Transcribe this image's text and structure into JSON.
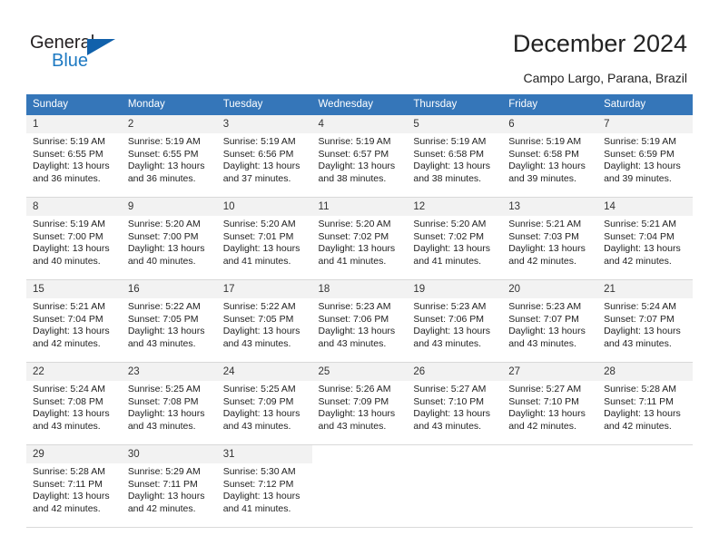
{
  "brand": {
    "name_part1": "General",
    "name_part2": "Blue",
    "triangle_icon": "triangle-icon",
    "color_dark": "#231f20",
    "color_blue": "#1d79c2"
  },
  "header": {
    "title": "December 2024",
    "subtitle": "Campo Largo, Parana, Brazil"
  },
  "theme": {
    "header_bg": "#3576b9",
    "header_text": "#ffffff",
    "daynum_bg": "#f2f2f2",
    "cell_bg": "#ffffff",
    "grid_line": "#d9d9d9"
  },
  "weekday_headers": [
    "Sunday",
    "Monday",
    "Tuesday",
    "Wednesday",
    "Thursday",
    "Friday",
    "Saturday"
  ],
  "labels": {
    "sunrise_prefix": "Sunrise:",
    "sunset_prefix": "Sunset:",
    "daylight_prefix": "Daylight:"
  },
  "weeks": [
    [
      {
        "day": "1",
        "sunrise": "Sunrise: 5:19 AM",
        "sunset": "Sunset: 6:55 PM",
        "daylight1": "Daylight: 13 hours",
        "daylight2": "and 36 minutes."
      },
      {
        "day": "2",
        "sunrise": "Sunrise: 5:19 AM",
        "sunset": "Sunset: 6:55 PM",
        "daylight1": "Daylight: 13 hours",
        "daylight2": "and 36 minutes."
      },
      {
        "day": "3",
        "sunrise": "Sunrise: 5:19 AM",
        "sunset": "Sunset: 6:56 PM",
        "daylight1": "Daylight: 13 hours",
        "daylight2": "and 37 minutes."
      },
      {
        "day": "4",
        "sunrise": "Sunrise: 5:19 AM",
        "sunset": "Sunset: 6:57 PM",
        "daylight1": "Daylight: 13 hours",
        "daylight2": "and 38 minutes."
      },
      {
        "day": "5",
        "sunrise": "Sunrise: 5:19 AM",
        "sunset": "Sunset: 6:58 PM",
        "daylight1": "Daylight: 13 hours",
        "daylight2": "and 38 minutes."
      },
      {
        "day": "6",
        "sunrise": "Sunrise: 5:19 AM",
        "sunset": "Sunset: 6:58 PM",
        "daylight1": "Daylight: 13 hours",
        "daylight2": "and 39 minutes."
      },
      {
        "day": "7",
        "sunrise": "Sunrise: 5:19 AM",
        "sunset": "Sunset: 6:59 PM",
        "daylight1": "Daylight: 13 hours",
        "daylight2": "and 39 minutes."
      }
    ],
    [
      {
        "day": "8",
        "sunrise": "Sunrise: 5:19 AM",
        "sunset": "Sunset: 7:00 PM",
        "daylight1": "Daylight: 13 hours",
        "daylight2": "and 40 minutes."
      },
      {
        "day": "9",
        "sunrise": "Sunrise: 5:20 AM",
        "sunset": "Sunset: 7:00 PM",
        "daylight1": "Daylight: 13 hours",
        "daylight2": "and 40 minutes."
      },
      {
        "day": "10",
        "sunrise": "Sunrise: 5:20 AM",
        "sunset": "Sunset: 7:01 PM",
        "daylight1": "Daylight: 13 hours",
        "daylight2": "and 41 minutes."
      },
      {
        "day": "11",
        "sunrise": "Sunrise: 5:20 AM",
        "sunset": "Sunset: 7:02 PM",
        "daylight1": "Daylight: 13 hours",
        "daylight2": "and 41 minutes."
      },
      {
        "day": "12",
        "sunrise": "Sunrise: 5:20 AM",
        "sunset": "Sunset: 7:02 PM",
        "daylight1": "Daylight: 13 hours",
        "daylight2": "and 41 minutes."
      },
      {
        "day": "13",
        "sunrise": "Sunrise: 5:21 AM",
        "sunset": "Sunset: 7:03 PM",
        "daylight1": "Daylight: 13 hours",
        "daylight2": "and 42 minutes."
      },
      {
        "day": "14",
        "sunrise": "Sunrise: 5:21 AM",
        "sunset": "Sunset: 7:04 PM",
        "daylight1": "Daylight: 13 hours",
        "daylight2": "and 42 minutes."
      }
    ],
    [
      {
        "day": "15",
        "sunrise": "Sunrise: 5:21 AM",
        "sunset": "Sunset: 7:04 PM",
        "daylight1": "Daylight: 13 hours",
        "daylight2": "and 42 minutes."
      },
      {
        "day": "16",
        "sunrise": "Sunrise: 5:22 AM",
        "sunset": "Sunset: 7:05 PM",
        "daylight1": "Daylight: 13 hours",
        "daylight2": "and 43 minutes."
      },
      {
        "day": "17",
        "sunrise": "Sunrise: 5:22 AM",
        "sunset": "Sunset: 7:05 PM",
        "daylight1": "Daylight: 13 hours",
        "daylight2": "and 43 minutes."
      },
      {
        "day": "18",
        "sunrise": "Sunrise: 5:23 AM",
        "sunset": "Sunset: 7:06 PM",
        "daylight1": "Daylight: 13 hours",
        "daylight2": "and 43 minutes."
      },
      {
        "day": "19",
        "sunrise": "Sunrise: 5:23 AM",
        "sunset": "Sunset: 7:06 PM",
        "daylight1": "Daylight: 13 hours",
        "daylight2": "and 43 minutes."
      },
      {
        "day": "20",
        "sunrise": "Sunrise: 5:23 AM",
        "sunset": "Sunset: 7:07 PM",
        "daylight1": "Daylight: 13 hours",
        "daylight2": "and 43 minutes."
      },
      {
        "day": "21",
        "sunrise": "Sunrise: 5:24 AM",
        "sunset": "Sunset: 7:07 PM",
        "daylight1": "Daylight: 13 hours",
        "daylight2": "and 43 minutes."
      }
    ],
    [
      {
        "day": "22",
        "sunrise": "Sunrise: 5:24 AM",
        "sunset": "Sunset: 7:08 PM",
        "daylight1": "Daylight: 13 hours",
        "daylight2": "and 43 minutes."
      },
      {
        "day": "23",
        "sunrise": "Sunrise: 5:25 AM",
        "sunset": "Sunset: 7:08 PM",
        "daylight1": "Daylight: 13 hours",
        "daylight2": "and 43 minutes."
      },
      {
        "day": "24",
        "sunrise": "Sunrise: 5:25 AM",
        "sunset": "Sunset: 7:09 PM",
        "daylight1": "Daylight: 13 hours",
        "daylight2": "and 43 minutes."
      },
      {
        "day": "25",
        "sunrise": "Sunrise: 5:26 AM",
        "sunset": "Sunset: 7:09 PM",
        "daylight1": "Daylight: 13 hours",
        "daylight2": "and 43 minutes."
      },
      {
        "day": "26",
        "sunrise": "Sunrise: 5:27 AM",
        "sunset": "Sunset: 7:10 PM",
        "daylight1": "Daylight: 13 hours",
        "daylight2": "and 43 minutes."
      },
      {
        "day": "27",
        "sunrise": "Sunrise: 5:27 AM",
        "sunset": "Sunset: 7:10 PM",
        "daylight1": "Daylight: 13 hours",
        "daylight2": "and 42 minutes."
      },
      {
        "day": "28",
        "sunrise": "Sunrise: 5:28 AM",
        "sunset": "Sunset: 7:11 PM",
        "daylight1": "Daylight: 13 hours",
        "daylight2": "and 42 minutes."
      }
    ],
    [
      {
        "day": "29",
        "sunrise": "Sunrise: 5:28 AM",
        "sunset": "Sunset: 7:11 PM",
        "daylight1": "Daylight: 13 hours",
        "daylight2": "and 42 minutes."
      },
      {
        "day": "30",
        "sunrise": "Sunrise: 5:29 AM",
        "sunset": "Sunset: 7:11 PM",
        "daylight1": "Daylight: 13 hours",
        "daylight2": "and 42 minutes."
      },
      {
        "day": "31",
        "sunrise": "Sunrise: 5:30 AM",
        "sunset": "Sunset: 7:12 PM",
        "daylight1": "Daylight: 13 hours",
        "daylight2": "and 41 minutes."
      },
      {
        "day": "",
        "sunrise": "",
        "sunset": "",
        "daylight1": "",
        "daylight2": ""
      },
      {
        "day": "",
        "sunrise": "",
        "sunset": "",
        "daylight1": "",
        "daylight2": ""
      },
      {
        "day": "",
        "sunrise": "",
        "sunset": "",
        "daylight1": "",
        "daylight2": ""
      },
      {
        "day": "",
        "sunrise": "",
        "sunset": "",
        "daylight1": "",
        "daylight2": ""
      }
    ]
  ]
}
